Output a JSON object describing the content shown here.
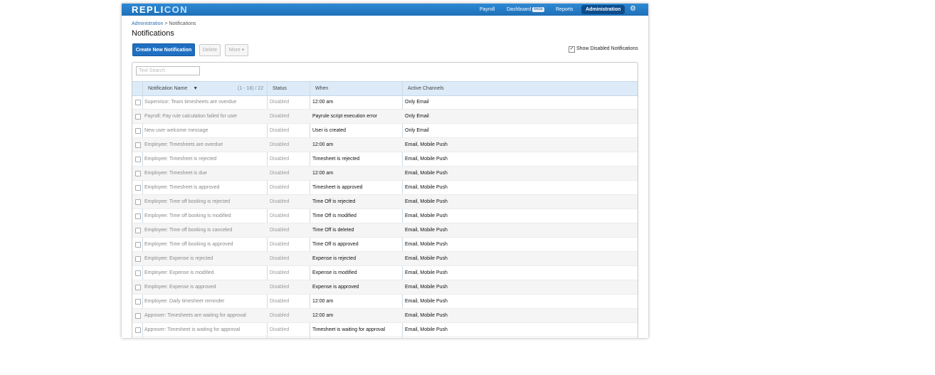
{
  "app": {
    "logo_pre": "REPLI",
    "logo_post": "CON",
    "nav": {
      "payroll": "Payroll",
      "dashboard": "Dashboard",
      "beta": "Beta",
      "reports": "Reports",
      "administration": "Administration"
    },
    "settings_icon": "gear-icon"
  },
  "breadcrumb": {
    "parent": "Administration",
    "separator": ">",
    "current": "Notifications"
  },
  "page_title": "Notifications",
  "toolbar": {
    "create_label": "Create New Notification",
    "delete_label": "Delete",
    "more_label": "More"
  },
  "show_disabled": {
    "label": "Show Disabled Notifications",
    "checked": true
  },
  "search": {
    "placeholder": "Text Search"
  },
  "table": {
    "columns": {
      "name": "Notification Name",
      "range": "(1 - 18) / 22",
      "status": "Status",
      "when": "When",
      "channels": "Active Channels"
    },
    "rows": [
      {
        "name": "Supervisor: Team timesheets are overdue",
        "status": "Disabled",
        "when": "12:00 am",
        "channels": "Only Email"
      },
      {
        "name": "Payroll: Pay rule calculation failed for user",
        "status": "Disabled",
        "when": "Payrule script execution error",
        "channels": "Only Email"
      },
      {
        "name": "New user welcome message",
        "status": "Disabled",
        "when": "User is created",
        "channels": "Only Email"
      },
      {
        "name": "Employee: Timesheets are overdue",
        "status": "Disabled",
        "when": "12:00 am",
        "channels": "Email, Mobile Push"
      },
      {
        "name": "Employee: Timesheet is rejected",
        "status": "Disabled",
        "when": "Timesheet is rejected",
        "channels": "Email, Mobile Push"
      },
      {
        "name": "Employee: Timesheet is due",
        "status": "Disabled",
        "when": "12:00 am",
        "channels": "Email, Mobile Push"
      },
      {
        "name": "Employee: Timesheet is approved",
        "status": "Disabled",
        "when": "Timesheet is approved",
        "channels": "Email, Mobile Push"
      },
      {
        "name": "Employee: Time off booking is rejected",
        "status": "Disabled",
        "when": "Time Off is rejected",
        "channels": "Email, Mobile Push"
      },
      {
        "name": "Employee: Time off booking is modified",
        "status": "Disabled",
        "when": "Time Off is modified",
        "channels": "Email, Mobile Push"
      },
      {
        "name": "Employee: Time off booking is canceled",
        "status": "Disabled",
        "when": "Time Off is deleted",
        "channels": "Email, Mobile Push"
      },
      {
        "name": "Employee: Time off booking is approved",
        "status": "Disabled",
        "when": "Time Off is approved",
        "channels": "Email, Mobile Push"
      },
      {
        "name": "Employee: Expense is rejected",
        "status": "Disabled",
        "when": "Expense is rejected",
        "channels": "Email, Mobile Push"
      },
      {
        "name": "Employee: Expense is modified",
        "status": "Disabled",
        "when": "Expense is modified",
        "channels": "Email, Mobile Push"
      },
      {
        "name": "Employee: Expense is approved",
        "status": "Disabled",
        "when": "Expense is approved",
        "channels": "Email, Mobile Push"
      },
      {
        "name": "Employee: Daily timesheet reminder",
        "status": "Disabled",
        "when": "12:00 am",
        "channels": "Email, Mobile Push"
      },
      {
        "name": "Approver: Timesheets are waiting for approval",
        "status": "Disabled",
        "when": "12:00 am",
        "channels": "Email, Mobile Push"
      },
      {
        "name": "Approver: Timesheet is waiting for approval",
        "status": "Disabled",
        "when": "Timesheet is waiting for approval",
        "channels": "Email, Mobile Push"
      }
    ]
  }
}
